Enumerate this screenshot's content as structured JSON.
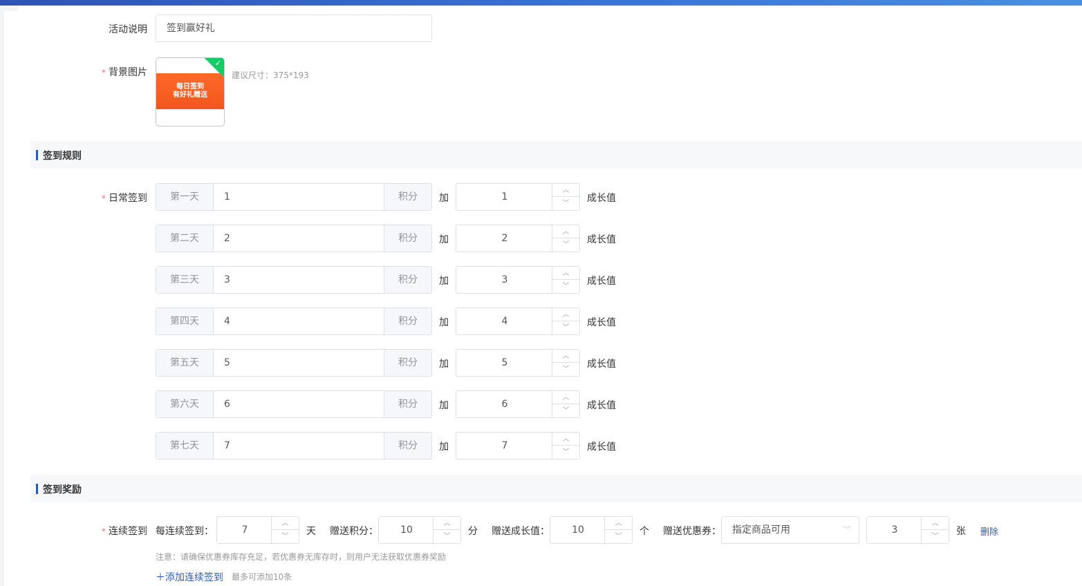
{
  "form": {
    "description_label": "活动说明",
    "description_value": "签到赢好礼",
    "bg_label": "背景图片",
    "bg_banner_line1": "每日签到",
    "bg_banner_line2": "有好礼赠送",
    "bg_hint": "建议尺寸：375*193"
  },
  "rules": {
    "section_title": "签到规则",
    "daily_label": "日常签到",
    "unit_points": "积分",
    "plus_text": "加",
    "unit_growth": "成长值",
    "days": [
      {
        "day": "第一天",
        "points": "1",
        "growth": "1"
      },
      {
        "day": "第二天",
        "points": "2",
        "growth": "2"
      },
      {
        "day": "第三天",
        "points": "3",
        "growth": "3"
      },
      {
        "day": "第四天",
        "points": "4",
        "growth": "4"
      },
      {
        "day": "第五天",
        "points": "5",
        "growth": "5"
      },
      {
        "day": "第六天",
        "points": "6",
        "growth": "6"
      },
      {
        "day": "第七天",
        "points": "7",
        "growth": "7"
      }
    ]
  },
  "rewards": {
    "section_title": "签到奖励",
    "consecutive_label": "连续签到",
    "every_label": "每连续签到：",
    "every_value": "7",
    "day_unit": "天",
    "gift_points_label": "赠送积分：",
    "gift_points_value": "10",
    "points_unit": "分",
    "gift_growth_label": "赠送成长值：",
    "gift_growth_value": "10",
    "growth_unit": "个",
    "gift_coupon_label": "赠送优惠券：",
    "coupon_select_value": "指定商品可用",
    "coupon_count": "3",
    "coupon_unit": "张",
    "delete_label": "删除",
    "note": "注意：请确保优惠券库存充足，若优惠券无库存时，则用户无法获取优惠券奖励",
    "add_label": "添加连续签到",
    "add_hint": "最多可添加10条"
  },
  "icons": {
    "up": "chevron-up-icon",
    "down": "chevron-down-icon",
    "check": "check-icon",
    "plus": "plus-icon"
  },
  "colors": {
    "primary": "#2f59b8",
    "required": "#f56c6c",
    "success": "#13ce66",
    "banner": "#f2551c"
  }
}
